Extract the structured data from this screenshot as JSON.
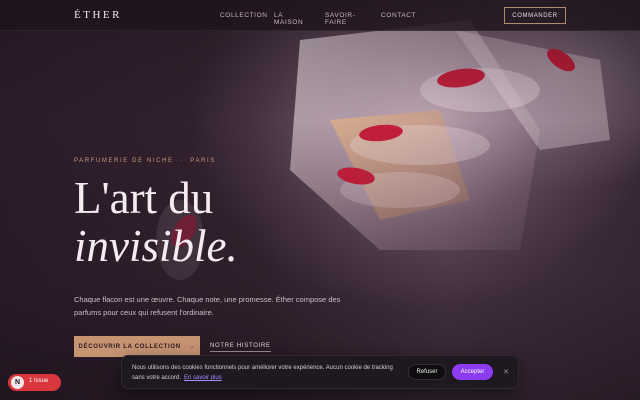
{
  "nav": {
    "logo": "ÉTHER",
    "links": [
      "COLLECTION",
      "LA MAISON",
      "SAVOIR-FAIRE",
      "CONTACT"
    ],
    "cta": "COMMANDER"
  },
  "hero": {
    "eyebrow": "PARFUMERIE DE NICHE  ·  PARIS",
    "headline_line1": "L'art du",
    "headline_line2": "invisible.",
    "lede": "Chaque flacon est une œuvre. Chaque note, une promesse. Éther compose des parfums pour ceux qui refusent l'ordinaire.",
    "primary_cta": "DÉCOUVRIR LA COLLECTION",
    "primary_cta_icon": "→",
    "secondary_cta": "NOTRE HISTOIRE"
  },
  "cookie_banner": {
    "text": "Nous utilisons des cookies fonctionnels pour améliorer votre expérience. Aucun cookie de tracking sans votre accord.",
    "link": "En savoir plus",
    "refuse": "Refuser",
    "accept": "Accepter",
    "close": "✕"
  },
  "issues_badge": {
    "icon_letter": "N",
    "label": "1 Issue"
  },
  "colors": {
    "background": "#2a1c29",
    "accent_copper": "#c79472",
    "accept_purple": "#8b3cf0",
    "issue_red": "#d9363e",
    "nail_red": "#c21f3c"
  }
}
